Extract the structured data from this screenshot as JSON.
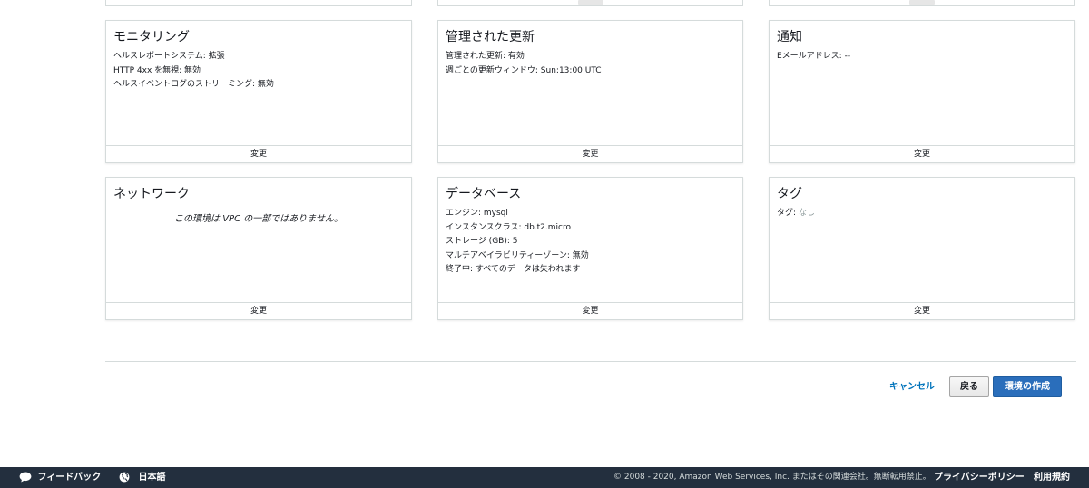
{
  "cards": {
    "monitoring": {
      "title": "モニタリング",
      "lines": [
        "ヘルスレポートシステム: 拡張",
        "HTTP 4xx を無視: 無効",
        "ヘルスイベントログのストリーミング: 無効"
      ],
      "edit_label": "変更"
    },
    "managed_updates": {
      "title": "管理された更新",
      "lines": [
        "管理された更新: 有効",
        "週ごとの更新ウィンドウ: Sun:13:00 UTC"
      ],
      "edit_label": "変更"
    },
    "notifications": {
      "title": "通知",
      "lines": [
        "Eメールアドレス: --"
      ],
      "edit_label": "変更"
    },
    "network": {
      "title": "ネットワーク",
      "message": "この環境は VPC の一部ではありません。",
      "edit_label": "変更"
    },
    "database": {
      "title": "データベース",
      "lines": [
        "エンジン: mysql",
        "インスタンスクラス: db.t2.micro",
        "ストレージ (GB): 5",
        "マルチアベイラビリティーゾーン: 無効",
        "終了中: すべてのデータは失われます"
      ],
      "edit_label": "変更"
    },
    "tags": {
      "title": "タグ",
      "tag_label": "タグ:",
      "tag_value": "なし",
      "edit_label": "変更"
    }
  },
  "actions": {
    "cancel_label": "キャンセル",
    "back_label": "戻る",
    "create_label": "環境の作成"
  },
  "footer": {
    "feedback_label": "フィードバック",
    "language_label": "日本語",
    "copyright": "© 2008 - 2020, Amazon Web Services, Inc. またはその関連会社。無断転用禁止。",
    "privacy_label": "プライバシーポリシー",
    "terms_label": "利用規約"
  },
  "icons": {
    "feedback": "speech-bubble-icon",
    "language": "globe-icon"
  },
  "colors": {
    "link": "#0073bb",
    "primary_button": "#2a6ebb",
    "footer_bg": "#232f3e"
  }
}
